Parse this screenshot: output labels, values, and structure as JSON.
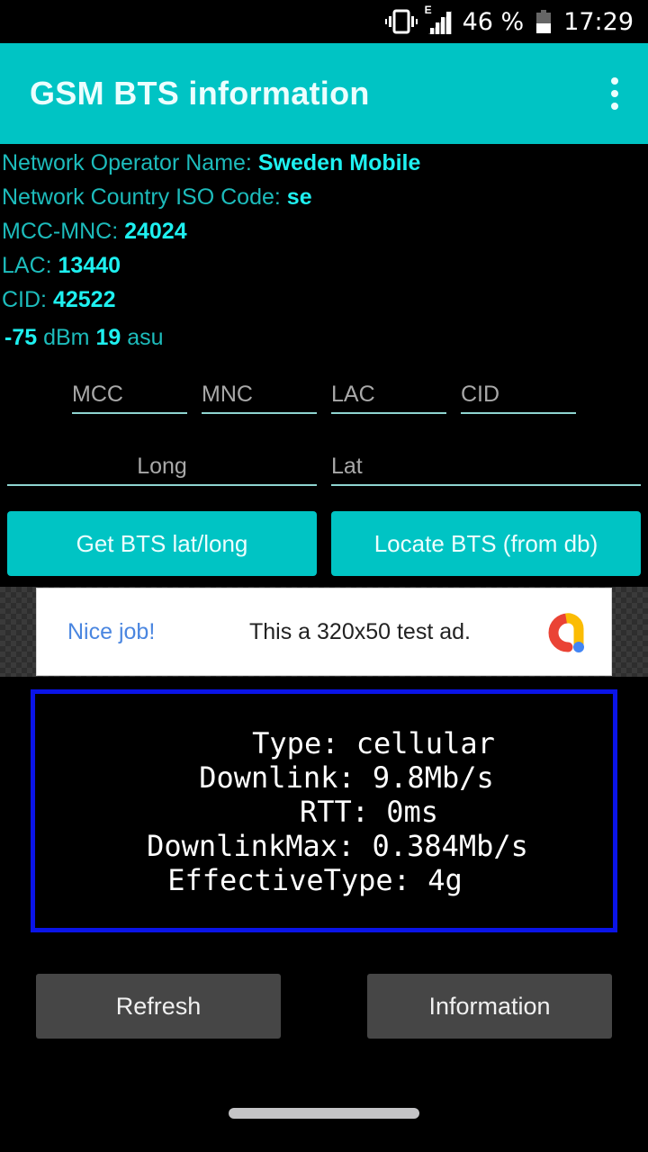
{
  "status_bar": {
    "vibrate_icon": "vibrate-icon",
    "network_type": "E",
    "signal_icon": "cell-signal-icon",
    "battery_percent_text": "46 %",
    "battery_level": 0.46,
    "time": "17:29"
  },
  "app_bar": {
    "title": "GSM BTS information",
    "menu_icon": "more-vert-icon"
  },
  "info": {
    "operator_label": "Network Operator Name: ",
    "operator_value": "Sweden Mobile",
    "iso_label": "Network Country ISO Code: ",
    "iso_value": "se",
    "mccmnc_label": "MCC-MNC: ",
    "mccmnc_value": "24024",
    "lac_label": "LAC: ",
    "lac_value": "13440",
    "cid_label": "CID: ",
    "cid_value": "42522",
    "dbm_value": "-75",
    "dbm_unit": " dBm ",
    "asu_value": "19",
    "asu_unit": " asu"
  },
  "inputs": {
    "mcc": {
      "placeholder": "MCC",
      "value": ""
    },
    "mnc": {
      "placeholder": "MNC",
      "value": ""
    },
    "lac": {
      "placeholder": "LAC",
      "value": ""
    },
    "cid": {
      "placeholder": "CID",
      "value": ""
    },
    "long": {
      "placeholder": "Long",
      "value": ""
    },
    "lat": {
      "placeholder": "Lat",
      "value": ""
    }
  },
  "buttons": {
    "get_latlong": "Get BTS lat/long",
    "locate_db": "Locate BTS (from db)",
    "refresh": "Refresh",
    "information": "Information"
  },
  "ad": {
    "headline": "Nice job!",
    "body": "This a 320x50 test ad.",
    "logo_icon": "admob-logo-icon"
  },
  "network_info": {
    "type": "Type: cellular",
    "downlink": "Downlink: 9.8Mb/s",
    "rtt": "RTT: 0ms",
    "downlink_max": "DownlinkMax: 0.384Mb/s",
    "effective_type": "EffectiveType: 4g"
  },
  "colors": {
    "accent": "#00c4c4",
    "label": "#1dbcbc",
    "value": "#1ef0f0",
    "box_border": "#0a14e8",
    "secondary_button": "#464646"
  }
}
